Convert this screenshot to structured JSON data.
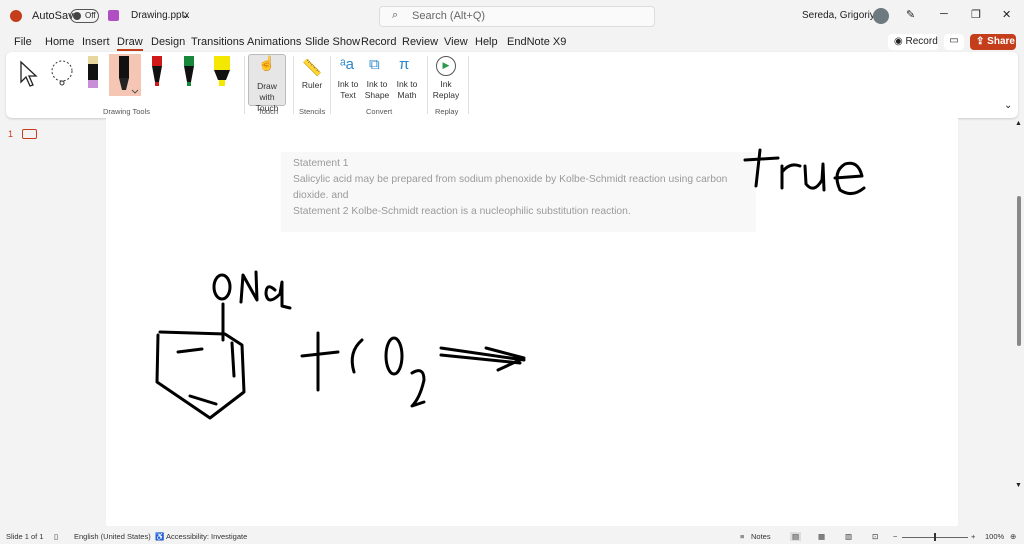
{
  "titlebar": {
    "autosave": "AutoSave",
    "toggle": "Off",
    "filename": "Drawing.pptx",
    "search_placeholder": "Search (Alt+Q)",
    "user": "Sereda, Grigoriy A"
  },
  "menu": [
    "File",
    "Home",
    "Insert",
    "Draw",
    "Design",
    "Transitions",
    "Animations",
    "Slide Show",
    "Record",
    "Review",
    "View",
    "Help",
    "EndNote X9"
  ],
  "actions": {
    "record": "Record",
    "share": "Share"
  },
  "ribbon": {
    "draw_with_touch": "Draw with Touch",
    "ruler": "Ruler",
    "ink_to_text": "Ink to Text",
    "ink_to_shape": "Ink to Shape",
    "ink_to_math": "Ink to Math",
    "ink_replay": "Ink Replay",
    "groups": {
      "drawing_tools": "Drawing Tools",
      "touch": "Touch",
      "stencils": "Stencils",
      "convert": "Convert",
      "replay": "Replay"
    }
  },
  "thumbnail": {
    "number": "1"
  },
  "slide": {
    "lines": [
      "Statement 1",
      "Salicylic acid may be prepared from sodium phenoxide by Kolbe-Schmidt reaction using carbon dioxide. and",
      "Statement 2 Kolbe-Schmidt reaction is a nucleophilic substitution reaction."
    ],
    "ink_answer": "true"
  },
  "status": {
    "slide": "Slide 1 of 1",
    "language": "English (United States)",
    "accessibility": "Accessibility: Investigate",
    "notes": "Notes",
    "zoom": "100%"
  },
  "colors": {
    "share": "#c43e1c",
    "accent": "#c43e1c"
  }
}
